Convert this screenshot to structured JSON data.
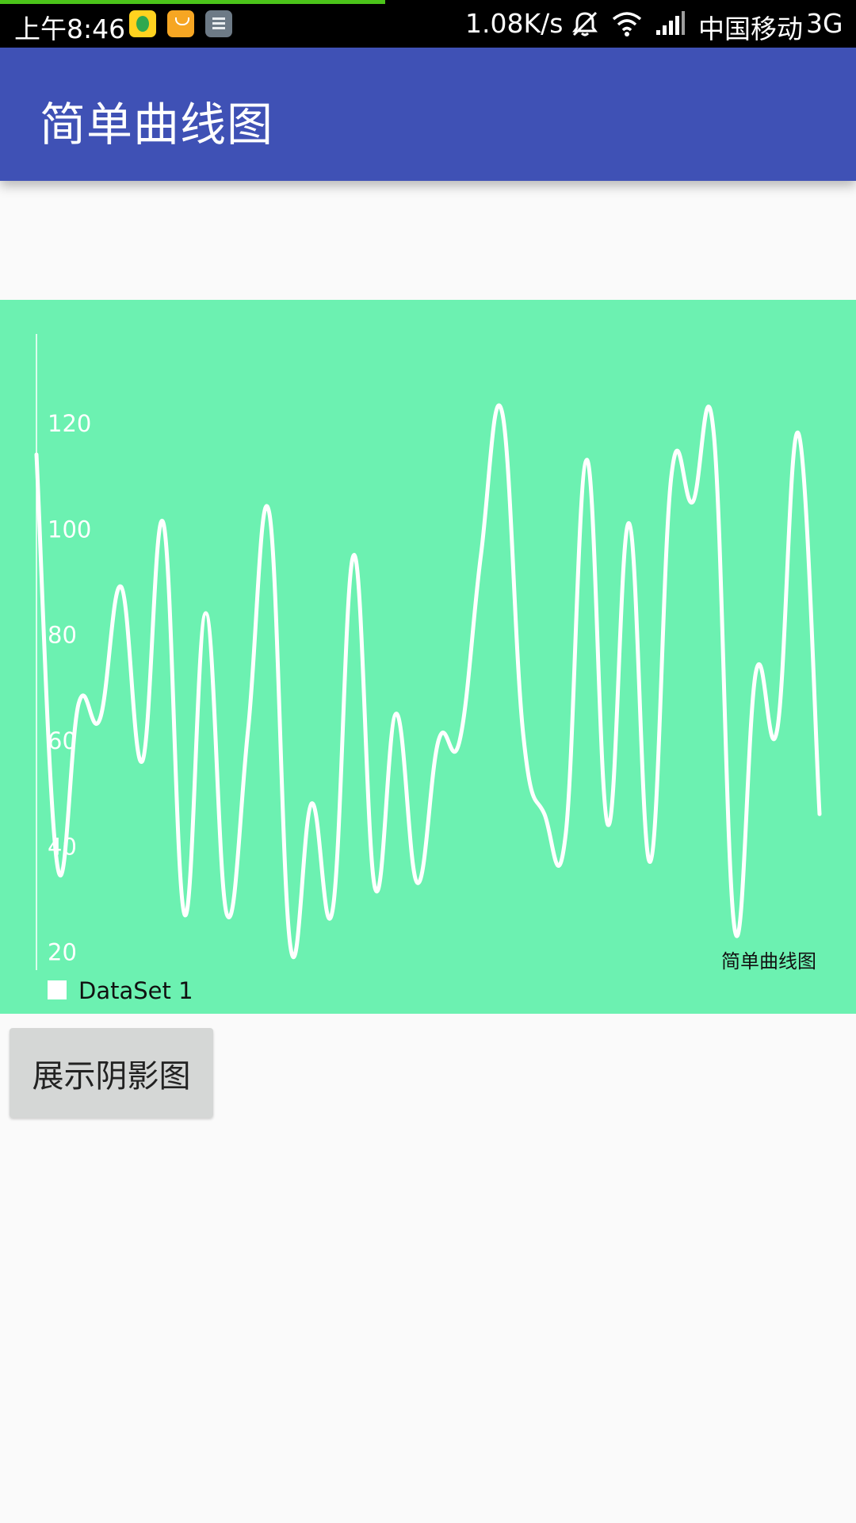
{
  "status_bar": {
    "time": "上午8:46",
    "network_speed": "1.08K/s",
    "carrier": "中国移动",
    "network_type": "3G",
    "page_load_progress": 0.45,
    "app_icons": [
      "qq-music-icon",
      "mi-store-icon",
      "calculator-icon"
    ],
    "status_icons": [
      "mute-icon",
      "wifi-icon",
      "signal-icon"
    ]
  },
  "app_bar": {
    "title": "简单曲线图",
    "color": "#3f51b5"
  },
  "chart_data": {
    "type": "line",
    "description_label": "简单曲线图",
    "series": [
      {
        "name": "DataSet 1",
        "color": "#ffffff",
        "values": [
          114,
          36,
          67,
          64,
          89,
          56,
          101,
          27,
          84,
          27,
          62,
          103,
          21,
          48,
          28,
          95,
          32,
          65,
          33,
          60,
          60,
          95,
          122,
          61,
          46,
          42,
          113,
          44,
          101,
          37,
          110,
          105,
          118,
          24,
          73,
          62,
          118,
          46
        ]
      }
    ],
    "y_ticks": [
      20,
      40,
      60,
      80,
      100,
      120
    ],
    "ylim": [
      16.5,
      136.5
    ],
    "background_color": "#6cf1b1",
    "legend": {
      "position": "bottom-left",
      "shape": "square"
    }
  },
  "button": {
    "label": "展示阴影图"
  }
}
